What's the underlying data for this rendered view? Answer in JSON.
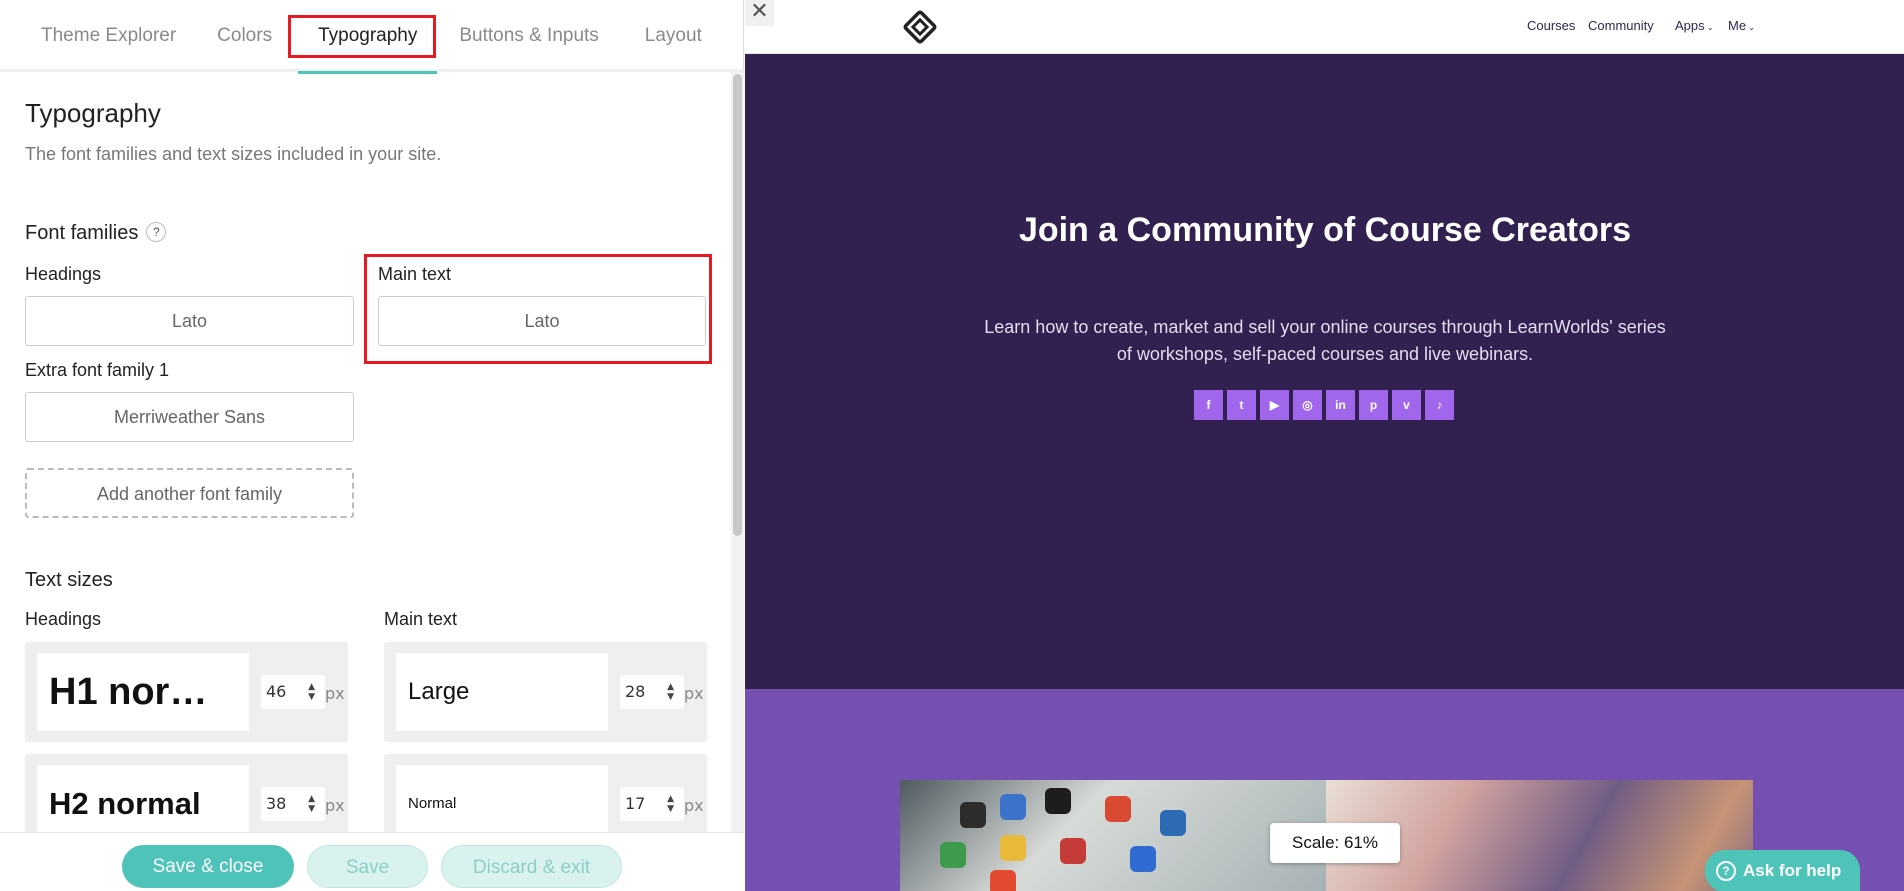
{
  "editor": {
    "tabs": [
      "Theme Explorer",
      "Colors",
      "Typography",
      "Buttons & Inputs",
      "Layout"
    ],
    "active_tab": "Typography",
    "section": {
      "title": "Typography",
      "description": "The font families and text sizes included in your site."
    },
    "font_families": {
      "title": "Font families",
      "help": "?",
      "headings_label": "Headings",
      "headings_value": "Lato",
      "main_label": "Main text",
      "main_value": "Lato",
      "extra_label": "Extra font family 1",
      "extra_value": "Merriweather Sans",
      "add_label": "Add another font family"
    },
    "text_sizes": {
      "title": "Text sizes",
      "headings_label": "Headings",
      "main_label": "Main text",
      "unit": "px",
      "headings": [
        {
          "name": "H1 nor…",
          "size": "46"
        },
        {
          "name": "H2 normal",
          "size": "38"
        }
      ],
      "main": [
        {
          "name": "Large",
          "size": "28"
        },
        {
          "name": "Normal",
          "size": "17"
        }
      ]
    },
    "footer": {
      "save_close": "Save & close",
      "save": "Save",
      "discard": "Discard & exit"
    }
  },
  "preview": {
    "close": "✕",
    "nav": {
      "courses": "Courses",
      "community": "Community",
      "apps": "Apps",
      "me": "Me"
    },
    "hero": {
      "title": "Join a Community of Course Creators",
      "subtitle": "Learn how to create, market and sell your online courses through LearnWorlds' series of workshops, self-paced courses and live webinars."
    },
    "socials": [
      "facebook-icon",
      "twitter-icon",
      "youtube-icon",
      "instagram-icon",
      "linkedin-icon",
      "pinterest-icon",
      "vimeo-icon",
      "tiktok-icon"
    ],
    "scale": "Scale: 61%",
    "help_button": "Ask for help",
    "colors": {
      "hero_bg": "#322150",
      "band_bg": "#7550b0",
      "social_bg": "#a067ec",
      "accent": "#4ec4b8"
    }
  }
}
